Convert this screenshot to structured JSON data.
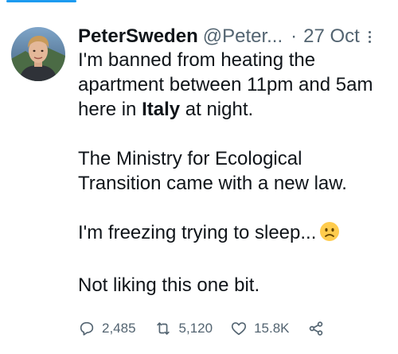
{
  "author": {
    "name": "PeterSweden",
    "handle": "@Peter...",
    "separator": "·",
    "date": "27 Oct"
  },
  "tweet": {
    "line1": "I'm banned from heating the",
    "line2": "apartment between 11pm and 5am",
    "line3_pre": "here in ",
    "line3_bold": "Italy",
    "line3_post": " at night.",
    "para2_line1": "The Ministry for Ecological",
    "para2_line2": "Transition came with a new law.",
    "para3": "I'm freezing trying to sleep...",
    "para3_emoji": "confused-face-icon",
    "para4": "Not liking this one bit."
  },
  "actions": {
    "replies": "2,485",
    "retweets": "5,120",
    "likes": "15.8K"
  },
  "colors": {
    "accent": "#1d9bf0",
    "text": "#0f1419",
    "muted": "#536471"
  }
}
